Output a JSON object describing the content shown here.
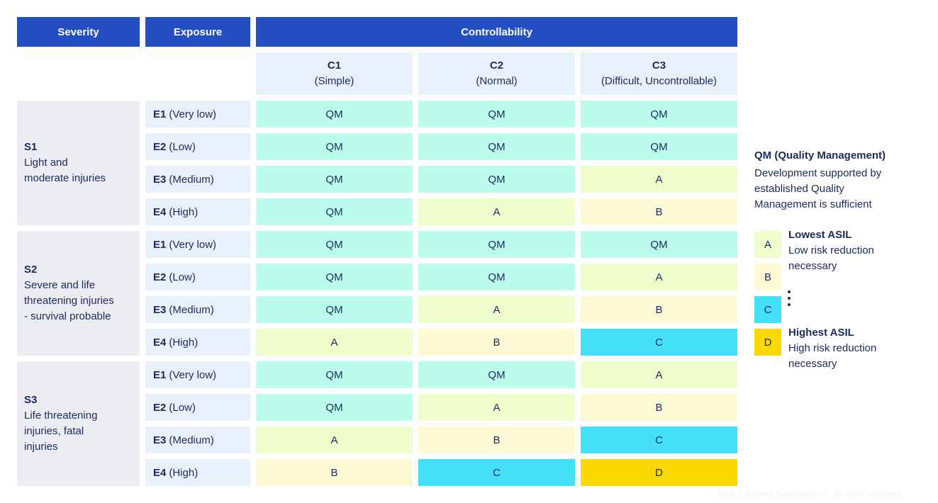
{
  "headers": {
    "severity": "Severity",
    "exposure": "Exposure",
    "controllability": "Controllability"
  },
  "controllability_classes": [
    {
      "code": "C1",
      "label": "(Simple)"
    },
    {
      "code": "C2",
      "label": "(Normal)"
    },
    {
      "code": "C3",
      "label": "(Difficult, Uncontrollable)"
    }
  ],
  "severity_groups": [
    {
      "code": "S1",
      "desc_lines": [
        "Light and",
        "moderate injuries"
      ],
      "rows": [
        {
          "exposure_code": "E1",
          "exposure_label": "(Very low)",
          "values": [
            "QM",
            "QM",
            "QM"
          ]
        },
        {
          "exposure_code": "E2",
          "exposure_label": "(Low)",
          "values": [
            "QM",
            "QM",
            "QM"
          ]
        },
        {
          "exposure_code": "E3",
          "exposure_label": "(Medium)",
          "values": [
            "QM",
            "QM",
            "A"
          ]
        },
        {
          "exposure_code": "E4",
          "exposure_label": "(High)",
          "values": [
            "QM",
            "A",
            "B"
          ]
        }
      ]
    },
    {
      "code": "S2",
      "desc_lines": [
        "Severe and life",
        "threatening injuries",
        "- survival probable"
      ],
      "rows": [
        {
          "exposure_code": "E1",
          "exposure_label": "(Very low)",
          "values": [
            "QM",
            "QM",
            "QM"
          ]
        },
        {
          "exposure_code": "E2",
          "exposure_label": "(Low)",
          "values": [
            "QM",
            "QM",
            "A"
          ]
        },
        {
          "exposure_code": "E3",
          "exposure_label": "(Medium)",
          "values": [
            "QM",
            "A",
            "B"
          ]
        },
        {
          "exposure_code": "E4",
          "exposure_label": "(High)",
          "values": [
            "A",
            "B",
            "C"
          ]
        }
      ]
    },
    {
      "code": "S3",
      "desc_lines": [
        "Life threatening",
        "injuries, fatal",
        "injuries"
      ],
      "rows": [
        {
          "exposure_code": "E1",
          "exposure_label": "(Very low)",
          "values": [
            "QM",
            "QM",
            "A"
          ]
        },
        {
          "exposure_code": "E2",
          "exposure_label": "(Low)",
          "values": [
            "QM",
            "A",
            "B"
          ]
        },
        {
          "exposure_code": "E3",
          "exposure_label": "(Medium)",
          "values": [
            "A",
            "B",
            "C"
          ]
        },
        {
          "exposure_code": "E4",
          "exposure_label": "(High)",
          "values": [
            "B",
            "C",
            "D"
          ]
        }
      ]
    }
  ],
  "legend": {
    "qm_title": "QM (Quality Management)",
    "qm_desc_lines": [
      "Development supported by",
      "established Quality",
      "Management is sufficient"
    ],
    "swatches": [
      "A",
      "B",
      "C",
      "D"
    ],
    "lowest": {
      "title": "Lowest ASIL",
      "desc_lines": [
        "Low risk reduction",
        "necessary"
      ]
    },
    "highest": {
      "title": "Highest ASIL",
      "desc_lines": [
        "High risk reduction",
        "necessary"
      ]
    }
  },
  "colors": {
    "header_blue": "#234fc2",
    "QM": "#bcfced",
    "A": "#effccc",
    "B": "#fef9d5",
    "C": "#45e0f8",
    "D": "#fbd800"
  },
  "footer": "© 2023, Lemberg Solutions LLC. All rights reserved"
}
